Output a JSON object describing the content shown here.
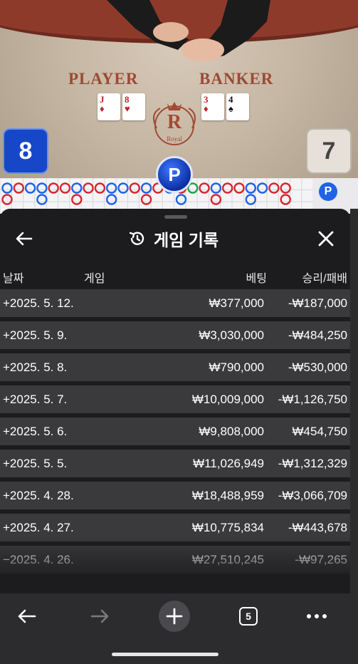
{
  "game": {
    "player_label": "PLAYER",
    "banker_label": "BANKER",
    "player_score": "8",
    "banker_score": "7",
    "chip_label": "P",
    "logo_letter": "R",
    "logo_text": "Royal",
    "player_cards": [
      {
        "rank": "J",
        "suit": "♦"
      },
      {
        "rank": "8",
        "suit": "♥"
      }
    ],
    "banker_cards": [
      {
        "rank": "3",
        "suit": "♦"
      },
      {
        "rank": "4",
        "suit": "♠"
      }
    ],
    "road_side_label": "P"
  },
  "sheet": {
    "title": "게임 기록",
    "title_icon": "history-icon",
    "columns": {
      "date": "날짜",
      "game": "게임",
      "bet": "베팅",
      "winloss": "승리/패배"
    },
    "rows": [
      {
        "date": "+2025. 5. 12.",
        "bet": "₩377,000",
        "winloss": "-₩187,000"
      },
      {
        "date": "+2025. 5. 9.",
        "bet": "₩3,030,000",
        "winloss": "-₩484,250"
      },
      {
        "date": "+2025. 5. 8.",
        "bet": "₩790,000",
        "winloss": "-₩530,000"
      },
      {
        "date": "+2025. 5. 7.",
        "bet": "₩10,009,000",
        "winloss": "-₩1,126,750"
      },
      {
        "date": "+2025. 5. 6.",
        "bet": "₩9,808,000",
        "winloss": "₩454,750"
      },
      {
        "date": "+2025. 5. 5.",
        "bet": "₩11,026,949",
        "winloss": "-₩1,312,329"
      },
      {
        "date": "+2025. 4. 28.",
        "bet": "₩18,488,959",
        "winloss": "-₩3,066,709"
      },
      {
        "date": "+2025. 4. 27.",
        "bet": "₩10,775,834",
        "winloss": "-₩443,678"
      },
      {
        "date": "−2025. 4. 26.",
        "bet": "₩27,510,245",
        "winloss": "-₩97,265"
      }
    ]
  },
  "toolbar": {
    "tab_count": "5"
  },
  "colors": {
    "player_blue": "#1747c9",
    "banker_red": "#c0252b",
    "row_bg": "#3a3a3c",
    "sheet_bg": "#1c1c1e"
  }
}
